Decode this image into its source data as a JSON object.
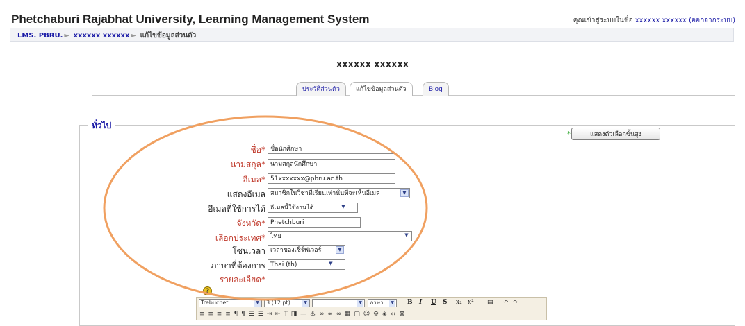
{
  "header": {
    "title": "Phetchaburi Rajabhat University, Learning Management System",
    "login_prefix": "คุณเข้าสู่ระบบในชื่อ",
    "user_name": "xxxxxx xxxxxx",
    "logout": "(ออกจากระบบ)"
  },
  "breadcrumb": {
    "home": "LMS. PBRU.",
    "user": "xxxxxx xxxxxx",
    "current": "แก้ไขข้อมูลส่วนตัว"
  },
  "page": {
    "heading": "xxxxxx xxxxxx"
  },
  "tabs": [
    {
      "label": "ประวัติส่วนตัว",
      "active": false
    },
    {
      "label": "แก้ไขข้อมูลส่วนตัว",
      "active": true
    },
    {
      "label": "Blog",
      "active": false
    }
  ],
  "section": {
    "legend": "ทั่วไป",
    "advanced_button": "แสดงตัวเลือกขั้นสูง",
    "advanced_marker": "*"
  },
  "form": {
    "firstname": {
      "label": "ชื่อ*",
      "value": "ชื่อนักศึกษา"
    },
    "lastname": {
      "label": "นามสกุล*",
      "value": "นามสกุลนักศึกษา"
    },
    "email": {
      "label": "อีเมล*",
      "value": "51xxxxxxx@pbru.ac.th"
    },
    "show_email": {
      "label": "แสดงอีเมล",
      "value": "สมาชิกในวิชาที่เรียนเท่านั้นที่จะเห็นอีเมล"
    },
    "email_enabled": {
      "label": "อีเมลที่ใช้การได้",
      "value": "อีเมลนี้ใช้งานได้"
    },
    "city": {
      "label": "จังหวัด*",
      "value": "Phetchburi"
    },
    "country": {
      "label": "เลือกประเทศ*",
      "value": "ไทย"
    },
    "timezone": {
      "label": "โซนเวลา",
      "value": "เวลาของเซิร์ฟเวอร์"
    },
    "language": {
      "label": "ภาษาที่ต้องการ",
      "value": "Thai (th)"
    },
    "description": {
      "label": "รายละเอียด*"
    }
  },
  "editor": {
    "font": "Trebuchet",
    "size": "3 (12 pt)",
    "style": "",
    "lang": "ภาษา",
    "bold": "B",
    "italic": "I",
    "underline": "U",
    "strike": "S",
    "row2_icons": "≡ ≡ ≡ ≡ ¶ ¶ ☰ ☰ ⇥ ⇤ T ◨ — ⚓ ∞ ∞ ∞ ▦ ▢ ☺ ⚙ ◈ ‹› ⊠"
  },
  "annotation": {
    "ellipse_color": "#f0a060"
  }
}
